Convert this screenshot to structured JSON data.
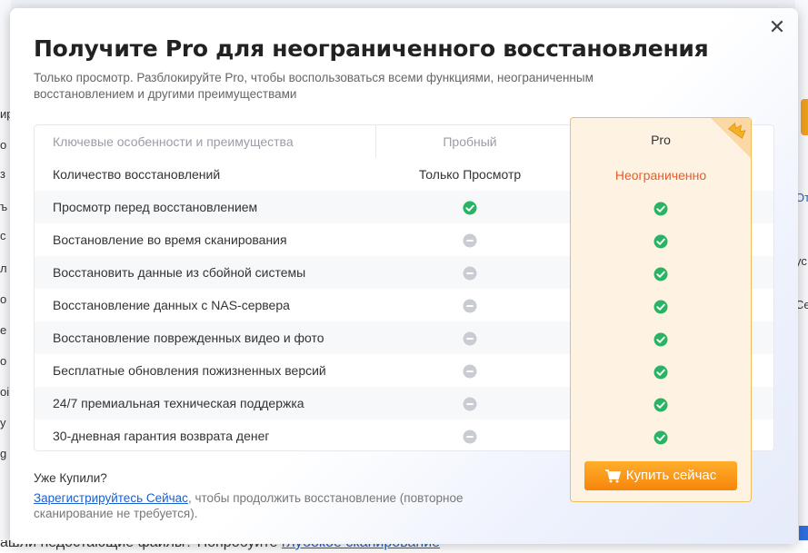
{
  "dialog": {
    "title": "Получите Pro для неограниченного восстановления",
    "subtitle": "Только просмотр. Разблокируйте Pro, чтобы воспользоваться всеми функциями, неограниченным восстановлением и другими преимуществами",
    "close_icon": "close-icon"
  },
  "table": {
    "headers": {
      "feature": "Ключевые особенности и преимущества",
      "trial": "Пробный",
      "pro": "Pro"
    },
    "recovery_row": {
      "label": "Количество восстановлений",
      "trial": "Только Просмотр",
      "pro": "Неограниченно"
    },
    "features": [
      {
        "label": "Просмотр перед восстановлением",
        "trial": "check",
        "pro": "check"
      },
      {
        "label": "Востановление во время сканирования",
        "trial": "minus",
        "pro": "check"
      },
      {
        "label": "Восстановить данные из сбойной системы",
        "trial": "minus",
        "pro": "check"
      },
      {
        "label": "Восстановление данных с NAS-сервера",
        "trial": "minus",
        "pro": "check"
      },
      {
        "label": "Восстановление поврежденных видео и фото",
        "trial": "minus",
        "pro": "check"
      },
      {
        "label": "Бесплатные обновления пожизненных версий",
        "trial": "minus",
        "pro": "check"
      },
      {
        "label": "24/7 премиальная техническая поддержка",
        "trial": "minus",
        "pro": "check"
      },
      {
        "label": "30-дневная гарантия возврата денег",
        "trial": "minus",
        "pro": "check"
      }
    ]
  },
  "buy_button": {
    "label": "Купить сейчас",
    "icon": "cart-icon"
  },
  "footer": {
    "already": "Уже Купили?",
    "register_link": "Зарегистрируйтесь Сейчас",
    "register_text": ", чтобы продолжить восстановление (повторное сканирование не требуется)."
  },
  "colors": {
    "check": "#28b463",
    "minus": "#c9ccd2",
    "accent_orange": "#f6850a",
    "unlimited": "#ec5a2a",
    "link": "#1a5fd0"
  },
  "background": {
    "left_fragments": [
      "ир",
      "о",
      "з",
      "ъ",
      "с",
      "л",
      "о",
      "е",
      "о",
      "oi",
      "у",
      "g"
    ],
    "right_fragments": [
      "От",
      "ус",
      "Се"
    ],
    "bottom_text": "ашли недостающие файлы? Попробуйте",
    "bottom_link": "глубокое сканирование"
  }
}
